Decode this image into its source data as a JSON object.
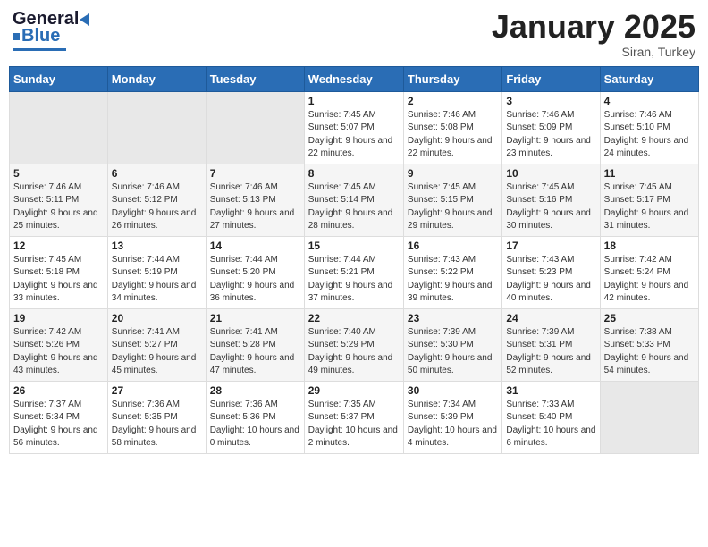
{
  "header": {
    "logo_general": "General",
    "logo_blue": "Blue",
    "month_title": "January 2025",
    "location": "Siran, Turkey"
  },
  "weekdays": [
    "Sunday",
    "Monday",
    "Tuesday",
    "Wednesday",
    "Thursday",
    "Friday",
    "Saturday"
  ],
  "weeks": [
    [
      {
        "day": "",
        "empty": true
      },
      {
        "day": "",
        "empty": true
      },
      {
        "day": "",
        "empty": true
      },
      {
        "day": "1",
        "sunrise": "7:45 AM",
        "sunset": "5:07 PM",
        "daylight": "9 hours and 22 minutes."
      },
      {
        "day": "2",
        "sunrise": "7:46 AM",
        "sunset": "5:08 PM",
        "daylight": "9 hours and 22 minutes."
      },
      {
        "day": "3",
        "sunrise": "7:46 AM",
        "sunset": "5:09 PM",
        "daylight": "9 hours and 23 minutes."
      },
      {
        "day": "4",
        "sunrise": "7:46 AM",
        "sunset": "5:10 PM",
        "daylight": "9 hours and 24 minutes."
      }
    ],
    [
      {
        "day": "5",
        "sunrise": "7:46 AM",
        "sunset": "5:11 PM",
        "daylight": "9 hours and 25 minutes."
      },
      {
        "day": "6",
        "sunrise": "7:46 AM",
        "sunset": "5:12 PM",
        "daylight": "9 hours and 26 minutes."
      },
      {
        "day": "7",
        "sunrise": "7:46 AM",
        "sunset": "5:13 PM",
        "daylight": "9 hours and 27 minutes."
      },
      {
        "day": "8",
        "sunrise": "7:45 AM",
        "sunset": "5:14 PM",
        "daylight": "9 hours and 28 minutes."
      },
      {
        "day": "9",
        "sunrise": "7:45 AM",
        "sunset": "5:15 PM",
        "daylight": "9 hours and 29 minutes."
      },
      {
        "day": "10",
        "sunrise": "7:45 AM",
        "sunset": "5:16 PM",
        "daylight": "9 hours and 30 minutes."
      },
      {
        "day": "11",
        "sunrise": "7:45 AM",
        "sunset": "5:17 PM",
        "daylight": "9 hours and 31 minutes."
      }
    ],
    [
      {
        "day": "12",
        "sunrise": "7:45 AM",
        "sunset": "5:18 PM",
        "daylight": "9 hours and 33 minutes."
      },
      {
        "day": "13",
        "sunrise": "7:44 AM",
        "sunset": "5:19 PM",
        "daylight": "9 hours and 34 minutes."
      },
      {
        "day": "14",
        "sunrise": "7:44 AM",
        "sunset": "5:20 PM",
        "daylight": "9 hours and 36 minutes."
      },
      {
        "day": "15",
        "sunrise": "7:44 AM",
        "sunset": "5:21 PM",
        "daylight": "9 hours and 37 minutes."
      },
      {
        "day": "16",
        "sunrise": "7:43 AM",
        "sunset": "5:22 PM",
        "daylight": "9 hours and 39 minutes."
      },
      {
        "day": "17",
        "sunrise": "7:43 AM",
        "sunset": "5:23 PM",
        "daylight": "9 hours and 40 minutes."
      },
      {
        "day": "18",
        "sunrise": "7:42 AM",
        "sunset": "5:24 PM",
        "daylight": "9 hours and 42 minutes."
      }
    ],
    [
      {
        "day": "19",
        "sunrise": "7:42 AM",
        "sunset": "5:26 PM",
        "daylight": "9 hours and 43 minutes."
      },
      {
        "day": "20",
        "sunrise": "7:41 AM",
        "sunset": "5:27 PM",
        "daylight": "9 hours and 45 minutes."
      },
      {
        "day": "21",
        "sunrise": "7:41 AM",
        "sunset": "5:28 PM",
        "daylight": "9 hours and 47 minutes."
      },
      {
        "day": "22",
        "sunrise": "7:40 AM",
        "sunset": "5:29 PM",
        "daylight": "9 hours and 49 minutes."
      },
      {
        "day": "23",
        "sunrise": "7:39 AM",
        "sunset": "5:30 PM",
        "daylight": "9 hours and 50 minutes."
      },
      {
        "day": "24",
        "sunrise": "7:39 AM",
        "sunset": "5:31 PM",
        "daylight": "9 hours and 52 minutes."
      },
      {
        "day": "25",
        "sunrise": "7:38 AM",
        "sunset": "5:33 PM",
        "daylight": "9 hours and 54 minutes."
      }
    ],
    [
      {
        "day": "26",
        "sunrise": "7:37 AM",
        "sunset": "5:34 PM",
        "daylight": "9 hours and 56 minutes."
      },
      {
        "day": "27",
        "sunrise": "7:36 AM",
        "sunset": "5:35 PM",
        "daylight": "9 hours and 58 minutes."
      },
      {
        "day": "28",
        "sunrise": "7:36 AM",
        "sunset": "5:36 PM",
        "daylight": "10 hours and 0 minutes."
      },
      {
        "day": "29",
        "sunrise": "7:35 AM",
        "sunset": "5:37 PM",
        "daylight": "10 hours and 2 minutes."
      },
      {
        "day": "30",
        "sunrise": "7:34 AM",
        "sunset": "5:39 PM",
        "daylight": "10 hours and 4 minutes."
      },
      {
        "day": "31",
        "sunrise": "7:33 AM",
        "sunset": "5:40 PM",
        "daylight": "10 hours and 6 minutes."
      },
      {
        "day": "",
        "empty": true
      }
    ]
  ]
}
